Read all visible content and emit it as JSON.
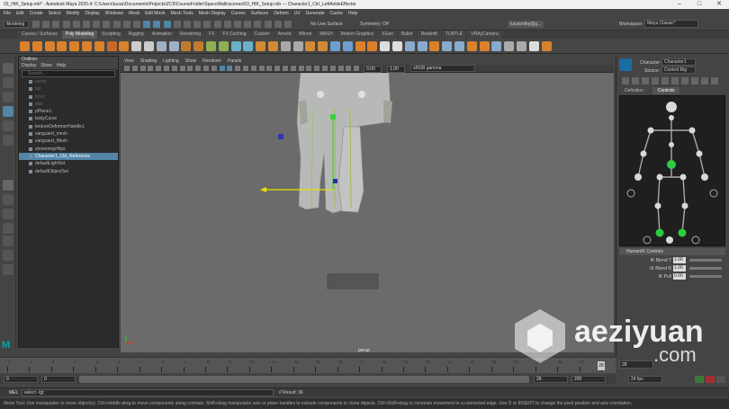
{
  "title_bar": {
    "title": "03_HIK_Setup.mb* - Autodesk Maya 2020.4: C:\\Users\\lucas\\Documents\\Projects\\ZC9\\CourseFolder\\SpaceWalk\\scenes\\03_HIK_Setup.mb  ---  Character1_Ctrl_LeftAnkleEffector"
  },
  "menus": [
    "File",
    "Edit",
    "Create",
    "Select",
    "Modify",
    "Display",
    "Windows",
    "Mesh",
    "Edit Mesh",
    "Mesh Tools",
    "Mesh Display",
    "Curves",
    "Surfaces",
    "Deform",
    "UV",
    "Generate",
    "Cache",
    "Help"
  ],
  "status_line": {
    "menu_set": "Modeling",
    "no_live_surface": "No Live Surface",
    "symmetry": "Symmetry: Off",
    "user": "lucasmlby@g...",
    "workspace_label": "Workspace:",
    "workspace": "Maya Classic*"
  },
  "shelf_tabs": [
    "Curves / Surfaces",
    "Poly Modeling",
    "Sculpting",
    "Rigging",
    "Animation",
    "Rendering",
    "FX",
    "FX Caching",
    "Custom",
    "Arnold",
    "Bifrost",
    "MASH",
    "Motion Graphics",
    "XGen",
    "Bullet",
    "Redshift",
    "TURTLE",
    "VRAyCamera"
  ],
  "shelf_active": "Poly Modeling",
  "outliner": {
    "title": "Outliner",
    "menus": [
      "Display",
      "Show",
      "Help"
    ],
    "search_placeholder": "Search...",
    "items": [
      {
        "label": "persp",
        "dim": true
      },
      {
        "label": "top",
        "dim": true
      },
      {
        "label": "front",
        "dim": true
      },
      {
        "label": "side",
        "dim": true
      },
      {
        "label": "pPlane1",
        "dim": false
      },
      {
        "label": "bodyCurve",
        "dim": false
      },
      {
        "label": "textureDeformerHandle1",
        "dim": false
      },
      {
        "label": "vanguard_mesh",
        "dim": false
      },
      {
        "label": "vanguard_Mesh",
        "dim": false
      },
      {
        "label": "stoneomgrHips",
        "dim": false
      },
      {
        "label": "Character1_Ctrl_Reference",
        "dim": false
      },
      {
        "label": "defaultLightSet",
        "dim": false
      },
      {
        "label": "defaultObjectSet",
        "dim": false
      }
    ],
    "selected_index": 10
  },
  "viewport": {
    "menus": [
      "View",
      "Shading",
      "Lighting",
      "Show",
      "Renderer",
      "Panels"
    ],
    "field_a": "0.00",
    "field_b": "1.00",
    "color_space": "sRGB gamma",
    "camera_label": "persp"
  },
  "hik": {
    "character_label": "Character:",
    "character": "Character1",
    "source_label": "Source:",
    "source": "Control Rig",
    "tabs": [
      "Definition",
      "Controls"
    ],
    "active_tab": "Controls",
    "section": "HumanIK Controls",
    "rows": [
      {
        "label": "IK Blend T",
        "value": "1.00"
      },
      {
        "label": "IK Blend R",
        "value": "1.00"
      },
      {
        "label": "IK Pull",
        "value": "0.00"
      }
    ]
  },
  "timeline": {
    "ticks": [
      "1",
      "2",
      "3",
      "4",
      "5",
      "6",
      "7",
      "8",
      "9",
      "10",
      "11",
      "12",
      "13",
      "14",
      "15",
      "16",
      "17",
      "18",
      "19",
      "20",
      "21",
      "22",
      "23",
      "24",
      "25",
      "26",
      "27",
      "28"
    ],
    "current_frame": "28",
    "current_frame_field": "28",
    "range_start": "0",
    "range_start_inner": "0",
    "range_end_inner": "28",
    "range_end": "200",
    "fps": "24 fps",
    "playhead_fraction": 1.0
  },
  "command_line": {
    "lang": "MEL",
    "command": "select -tgl;",
    "result": "// Result: 36"
  },
  "help_line": "Move Tool: Use manipulator to move object(s). Ctrl+middle-drag to move components along normals. Shift+drag manipulator axis or plane handles to extrude components or clone objects. Ctrl+Shift+drag to constrain movement to a connected edge. Use D or INSERT to change the pivot position and axis orientation.",
  "watermark": {
    "text": "aeziyuan",
    "sub": ".com"
  },
  "colors": {
    "accent": "#5285a6",
    "selected_joint": "#2ecc40",
    "viewport_bg": "#6b6b6b"
  }
}
